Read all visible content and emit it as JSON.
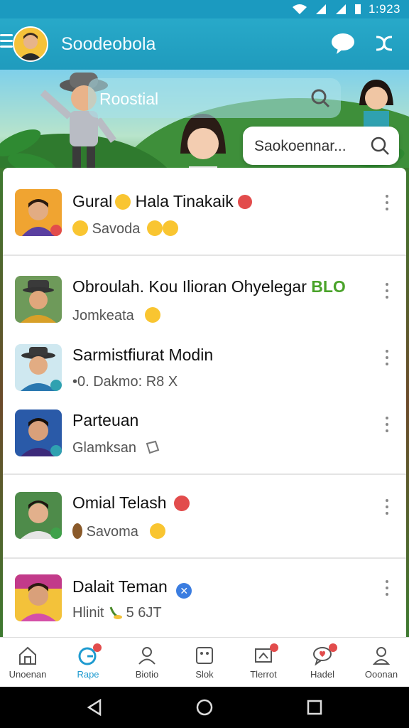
{
  "status_bar": {
    "time": "1:923"
  },
  "app_bar": {
    "title": "Soodeobola"
  },
  "banner": {
    "search_text": "Roostial"
  },
  "search": {
    "placeholder": "Saokoennar..."
  },
  "chats": [
    {
      "name": "Gural",
      "name_suffix": "Hala Tinakaik",
      "message": "Savoda"
    },
    {
      "name": "Obroulah. Kou Ilioran Ohyelegar",
      "badge": "BLO",
      "message": "Jomkeata"
    },
    {
      "name": "Sarmistfiurat Modin",
      "message": "•0. Dakmo: R8 X"
    },
    {
      "name": "Parteuan",
      "message": "Glamksan"
    },
    {
      "name": "Omial Telash",
      "message": "Savoma"
    },
    {
      "name": "Dalait Teman",
      "message": "Hlinit",
      "message_suffix": "5 6JT"
    }
  ],
  "bottom_nav": [
    {
      "label": "Unoenan",
      "icon": "home-icon"
    },
    {
      "label": "Rape",
      "icon": "chats-icon"
    },
    {
      "label": "Biotio",
      "icon": "contacts-icon"
    },
    {
      "label": "Slok",
      "icon": "stickers-icon"
    },
    {
      "label": "Tlerrot",
      "icon": "feed-icon"
    },
    {
      "label": "Hadel",
      "icon": "likes-icon"
    },
    {
      "label": "Ooonan",
      "icon": "profile-icon"
    }
  ],
  "colors": {
    "accent": "#1f9bbd",
    "badge": "#e24c4c"
  }
}
